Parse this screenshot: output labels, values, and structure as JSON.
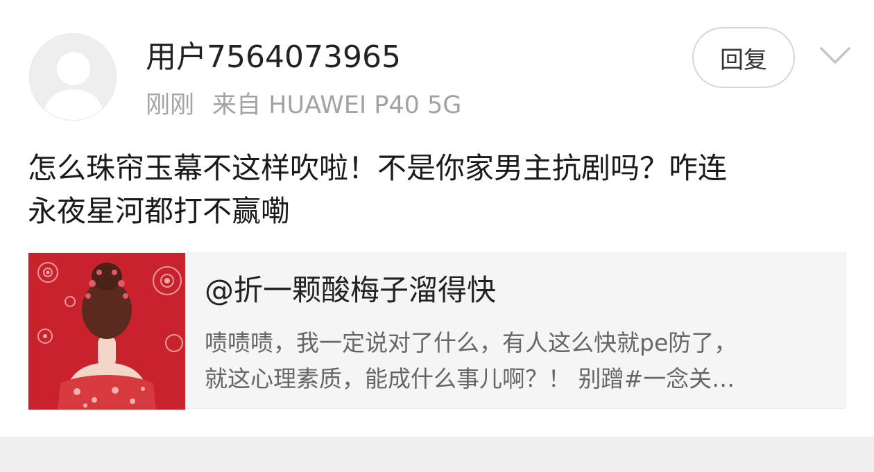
{
  "comment": {
    "username": "用户7564073965",
    "time": "刚刚",
    "source": "来自 HUAWEI P40 5G",
    "reply_label": "回复",
    "text_line1": "怎么珠帘玉幕不这样吹啦！不是你家男主抗剧吗？咋连",
    "text_line2": "永夜星河都打不赢嘞"
  },
  "quote": {
    "title": "@折一颗酸梅子溜得快",
    "body_line1": "啧啧啧，我一定说对了什么，有人这么快就pe防了，",
    "body_line2": "就这心理素质，能成什么事儿啊？！ 别蹭#一念关…"
  },
  "icons": {
    "avatar": "default-user-avatar-icon",
    "more": "chevron-down-icon"
  },
  "colors": {
    "username": "#222222",
    "meta": "#a3a3a3",
    "card_bg": "#f5f5f5",
    "thumb_bg": "#c8232c"
  }
}
